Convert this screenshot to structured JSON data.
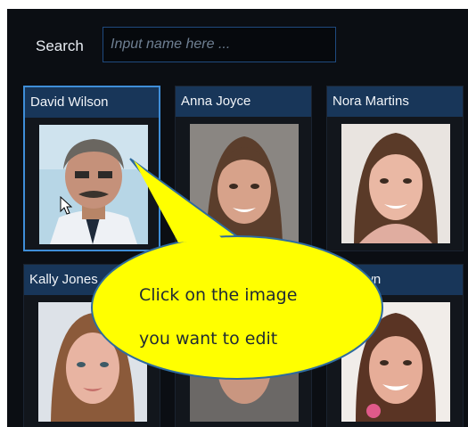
{
  "search": {
    "label": "Search",
    "placeholder": "Input name here ...",
    "value": ""
  },
  "people": [
    {
      "name": "David Wilson",
      "selected": true
    },
    {
      "name": "Anna Joyce",
      "selected": false
    },
    {
      "name": "Nora Martins",
      "selected": false
    },
    {
      "name": "Kally Jones",
      "selected": false
    },
    {
      "name": "",
      "selected": false
    },
    {
      "name": "y Brown",
      "selected": false
    }
  ],
  "callout": {
    "line1": "Click on the image",
    "line2": "you want to edit"
  },
  "colors": {
    "panel_bg": "#0b0e13",
    "card_header": "#183659",
    "selected_border": "#3f8ed8",
    "callout_fill": "#ffff00",
    "callout_border": "#2e6b9e"
  }
}
